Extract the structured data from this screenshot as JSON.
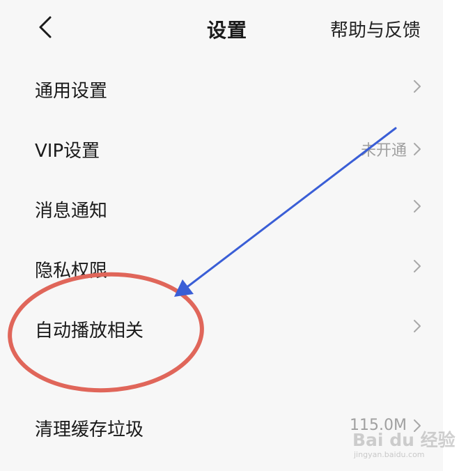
{
  "header": {
    "title": "设置",
    "help_label": "帮助与反馈",
    "back_icon": "chevron-left-icon"
  },
  "menu": {
    "items": [
      {
        "label": "通用设置",
        "value": ""
      },
      {
        "label": "VIP设置",
        "value": "未开通"
      },
      {
        "label": "消息通知",
        "value": ""
      },
      {
        "label": "隐私权限",
        "value": ""
      },
      {
        "label": "自动播放相关",
        "value": ""
      },
      {
        "label": "清理缓存垃圾",
        "value": "115.0M"
      }
    ]
  },
  "annotation": {
    "circle_color": "#e0665a",
    "arrow_color": "#3a5ed6"
  },
  "watermark": {
    "main": "Bai du 经验",
    "sub": "jingyan.baidu.com"
  }
}
